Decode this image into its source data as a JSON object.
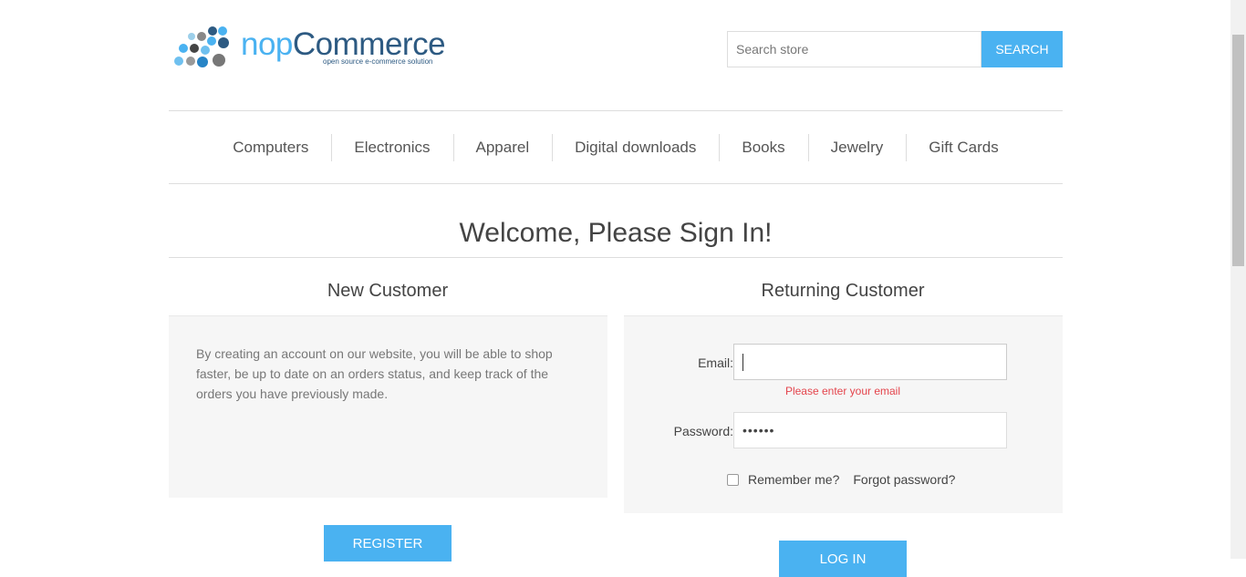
{
  "logo": {
    "name_part1": "nop",
    "name_part2": "Commerce",
    "tagline": "open source e-commerce solution"
  },
  "search": {
    "placeholder": "Search store",
    "button_label": "Search"
  },
  "menu": {
    "items": [
      "Computers",
      "Electronics",
      "Apparel",
      "Digital downloads",
      "Books",
      "Jewelry",
      "Gift Cards"
    ]
  },
  "page": {
    "title": "Welcome, Please Sign In!"
  },
  "new_customer": {
    "title": "New Customer",
    "text": "By creating an account on our website, you will be able to shop faster, be up to date on an orders status, and keep track of the orders you have previously made.",
    "register_label": "Register"
  },
  "returning_customer": {
    "title": "Returning Customer",
    "email_label": "Email:",
    "email_value": "",
    "email_error": "Please enter your email",
    "password_label": "Password:",
    "password_mask": "••••••",
    "remember_label": "Remember me?",
    "forgot_label": "Forgot password?",
    "login_label": "Log in"
  },
  "colors": {
    "accent": "#4ab2f1",
    "brand_dark": "#2d5a82",
    "error": "#e4444c"
  }
}
